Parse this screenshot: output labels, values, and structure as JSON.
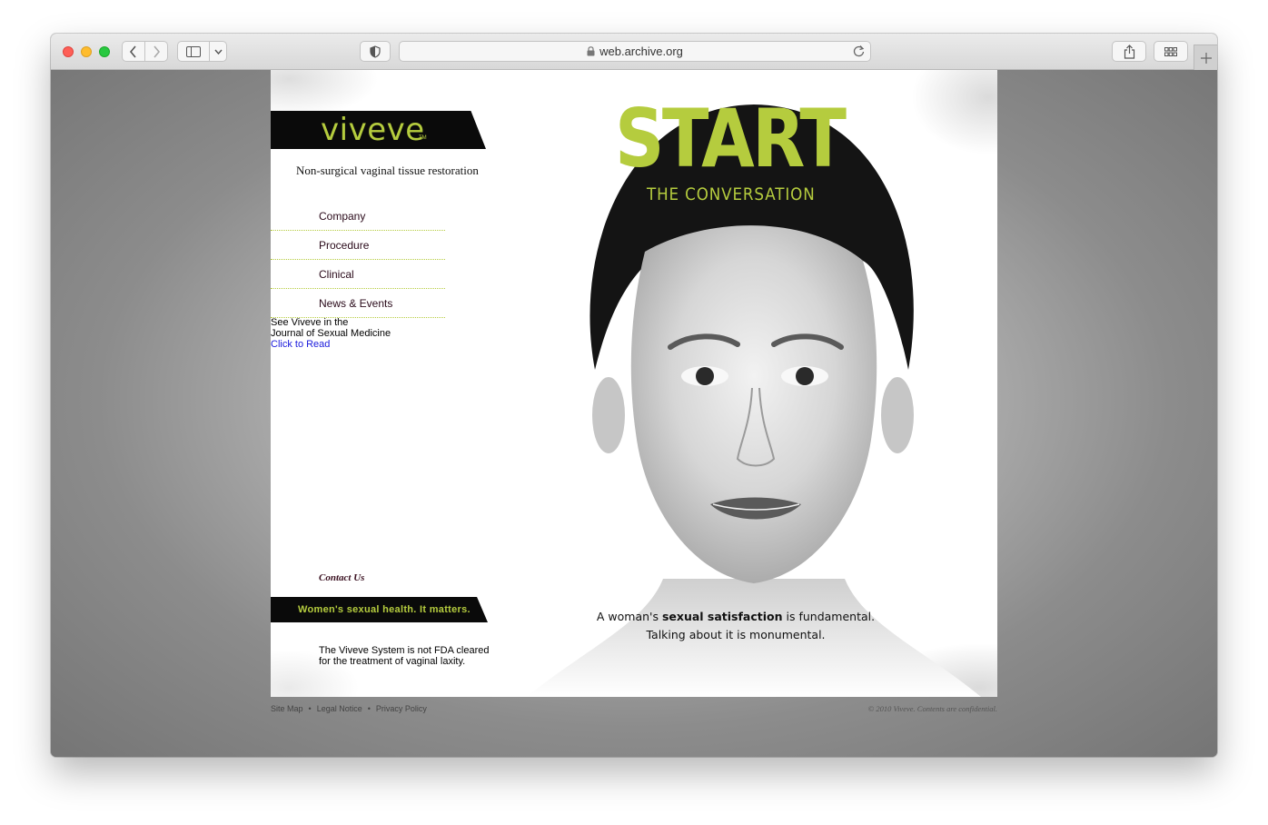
{
  "browser": {
    "url": "web.archive.org"
  },
  "site": {
    "logo": "viveve",
    "logo_tm": "TM",
    "tagline": "Non-surgical vaginal tissue restoration",
    "nav": [
      {
        "label": "Company"
      },
      {
        "label": "Procedure"
      },
      {
        "label": "Clinical"
      },
      {
        "label": "News & Events"
      }
    ],
    "journal": {
      "line1": "See Viveve in the",
      "line2": "Journal of Sexual Medicine",
      "link": "Click to Read"
    },
    "contact": "Contact Us",
    "slogan": "Women's sexual health. It matters.",
    "disclaimer": {
      "line1": "The Viveve System is not FDA cleared",
      "line2": "for the treatment of vaginal laxity."
    },
    "hero": {
      "headline": "START",
      "subheadline": "THE CONVERSATION",
      "quote_part1": "A woman's ",
      "quote_bold": "sexual satisfaction",
      "quote_part2": " is fundamental.",
      "quote_line2": "Talking about it is monumental."
    },
    "footer": {
      "links": [
        "Site Map",
        "Legal Notice",
        "Privacy Policy"
      ],
      "separator": "•",
      "copyright": "© 2010 Viveve. Contents are confidential."
    },
    "colors": {
      "accent": "#b5cc3e",
      "bar": "#0a0a0a",
      "link": "#1a1adc"
    }
  }
}
